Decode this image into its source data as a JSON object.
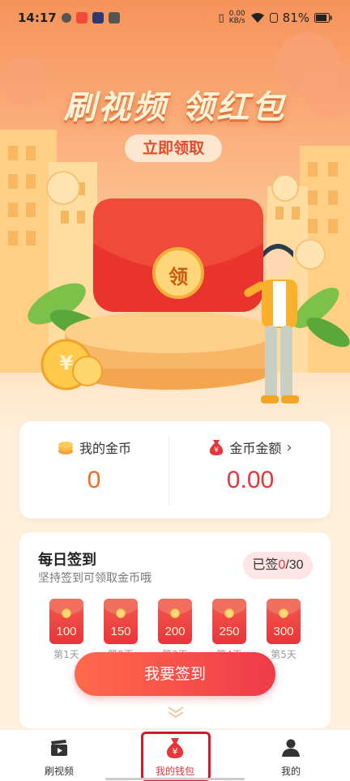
{
  "status_bar": {
    "time": "14:17",
    "net_speed_value": "0.00",
    "net_speed_unit": "KB/s",
    "battery": "81%"
  },
  "hero": {
    "title": "刷视频 领红包",
    "claim_button": "立即领取",
    "envelope_badge": "领"
  },
  "coins": {
    "my_coins_label": "我的金币",
    "my_coins_value": "0",
    "coin_amount_label": "金币金额",
    "coin_amount_value": "0.00",
    "chevron": "›"
  },
  "sign_in": {
    "title": "每日签到",
    "subtitle": "坚持签到可领取金币哦",
    "signed_prefix": "已签",
    "signed_count": "0",
    "signed_total": "/30",
    "rewards": [
      {
        "amount": "100",
        "day": "第1天"
      },
      {
        "amount": "150",
        "day": "第2天"
      },
      {
        "amount": "200",
        "day": "第3天"
      },
      {
        "amount": "250",
        "day": "第4天"
      },
      {
        "amount": "300",
        "day": "第5天"
      }
    ],
    "button": "我要签到"
  },
  "bottom_nav": {
    "items": [
      {
        "label": "刷视频",
        "icon": "video-clapper-icon"
      },
      {
        "label": "我的钱包",
        "icon": "money-bag-icon"
      },
      {
        "label": "我的",
        "icon": "person-icon"
      }
    ]
  },
  "colors": {
    "accent_red": "#e8343b",
    "accent_orange": "#f06a21",
    "hero_top": "#f6935b"
  }
}
